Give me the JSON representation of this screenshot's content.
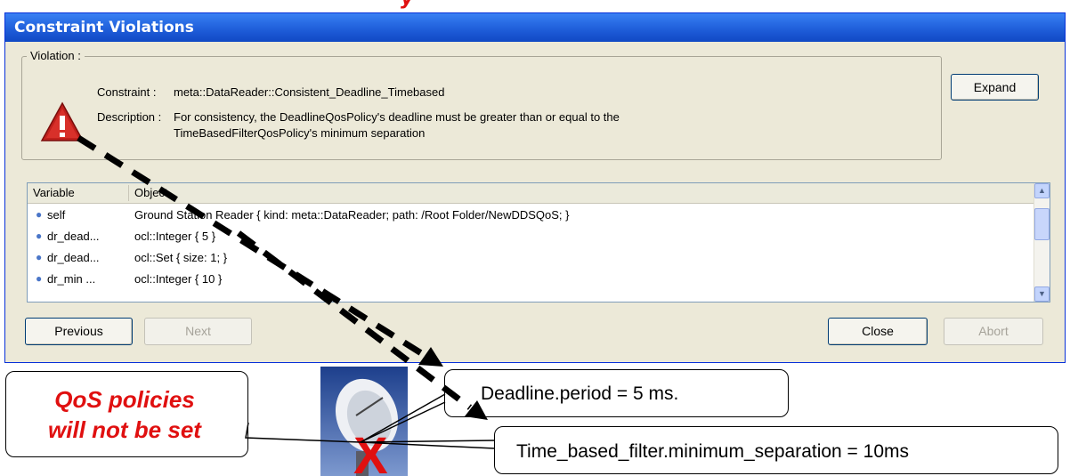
{
  "top_text": "y",
  "window": {
    "title": "Constraint Violations",
    "group_label": "Violation :",
    "constraint_label": "Constraint :",
    "constraint_value": "meta::DataReader::Consistent_Deadline_Timebased",
    "description_label": "Description :",
    "description_line1": "For consistency, the DeadlineQosPolicy's deadline must be greater than or equal to the",
    "description_line2": "TimeBasedFilterQosPolicy's minimum separation",
    "expand_button": "Expand",
    "list": {
      "columns": [
        "Variable",
        "Object"
      ],
      "rows": [
        {
          "variable": "self",
          "object": "Ground Station Reader { kind: meta::DataReader; path: /Root Folder/NewDDSQoS; }"
        },
        {
          "variable": "dr_dead...",
          "object": "ocl::Integer { 5 }"
        },
        {
          "variable": "dr_dead...",
          "object": "ocl::Set { size: 1; }"
        },
        {
          "variable": "dr_min ...",
          "object": "ocl::Integer { 10 }"
        }
      ]
    },
    "buttons": {
      "previous": "Previous",
      "next": "Next",
      "close": "Close",
      "abort": "Abort"
    }
  },
  "callouts": {
    "qos_line1": "QoS policies",
    "qos_line2": "will not be set",
    "deadline": "Deadline.period = 5 ms.",
    "time_based": "Time_based_filter.minimum_separation = 10ms"
  },
  "dish_mark": "X",
  "colors": {
    "title_bar": "#1a56d3",
    "window_bg": "#ece9d8",
    "callout_red": "#e01010"
  }
}
